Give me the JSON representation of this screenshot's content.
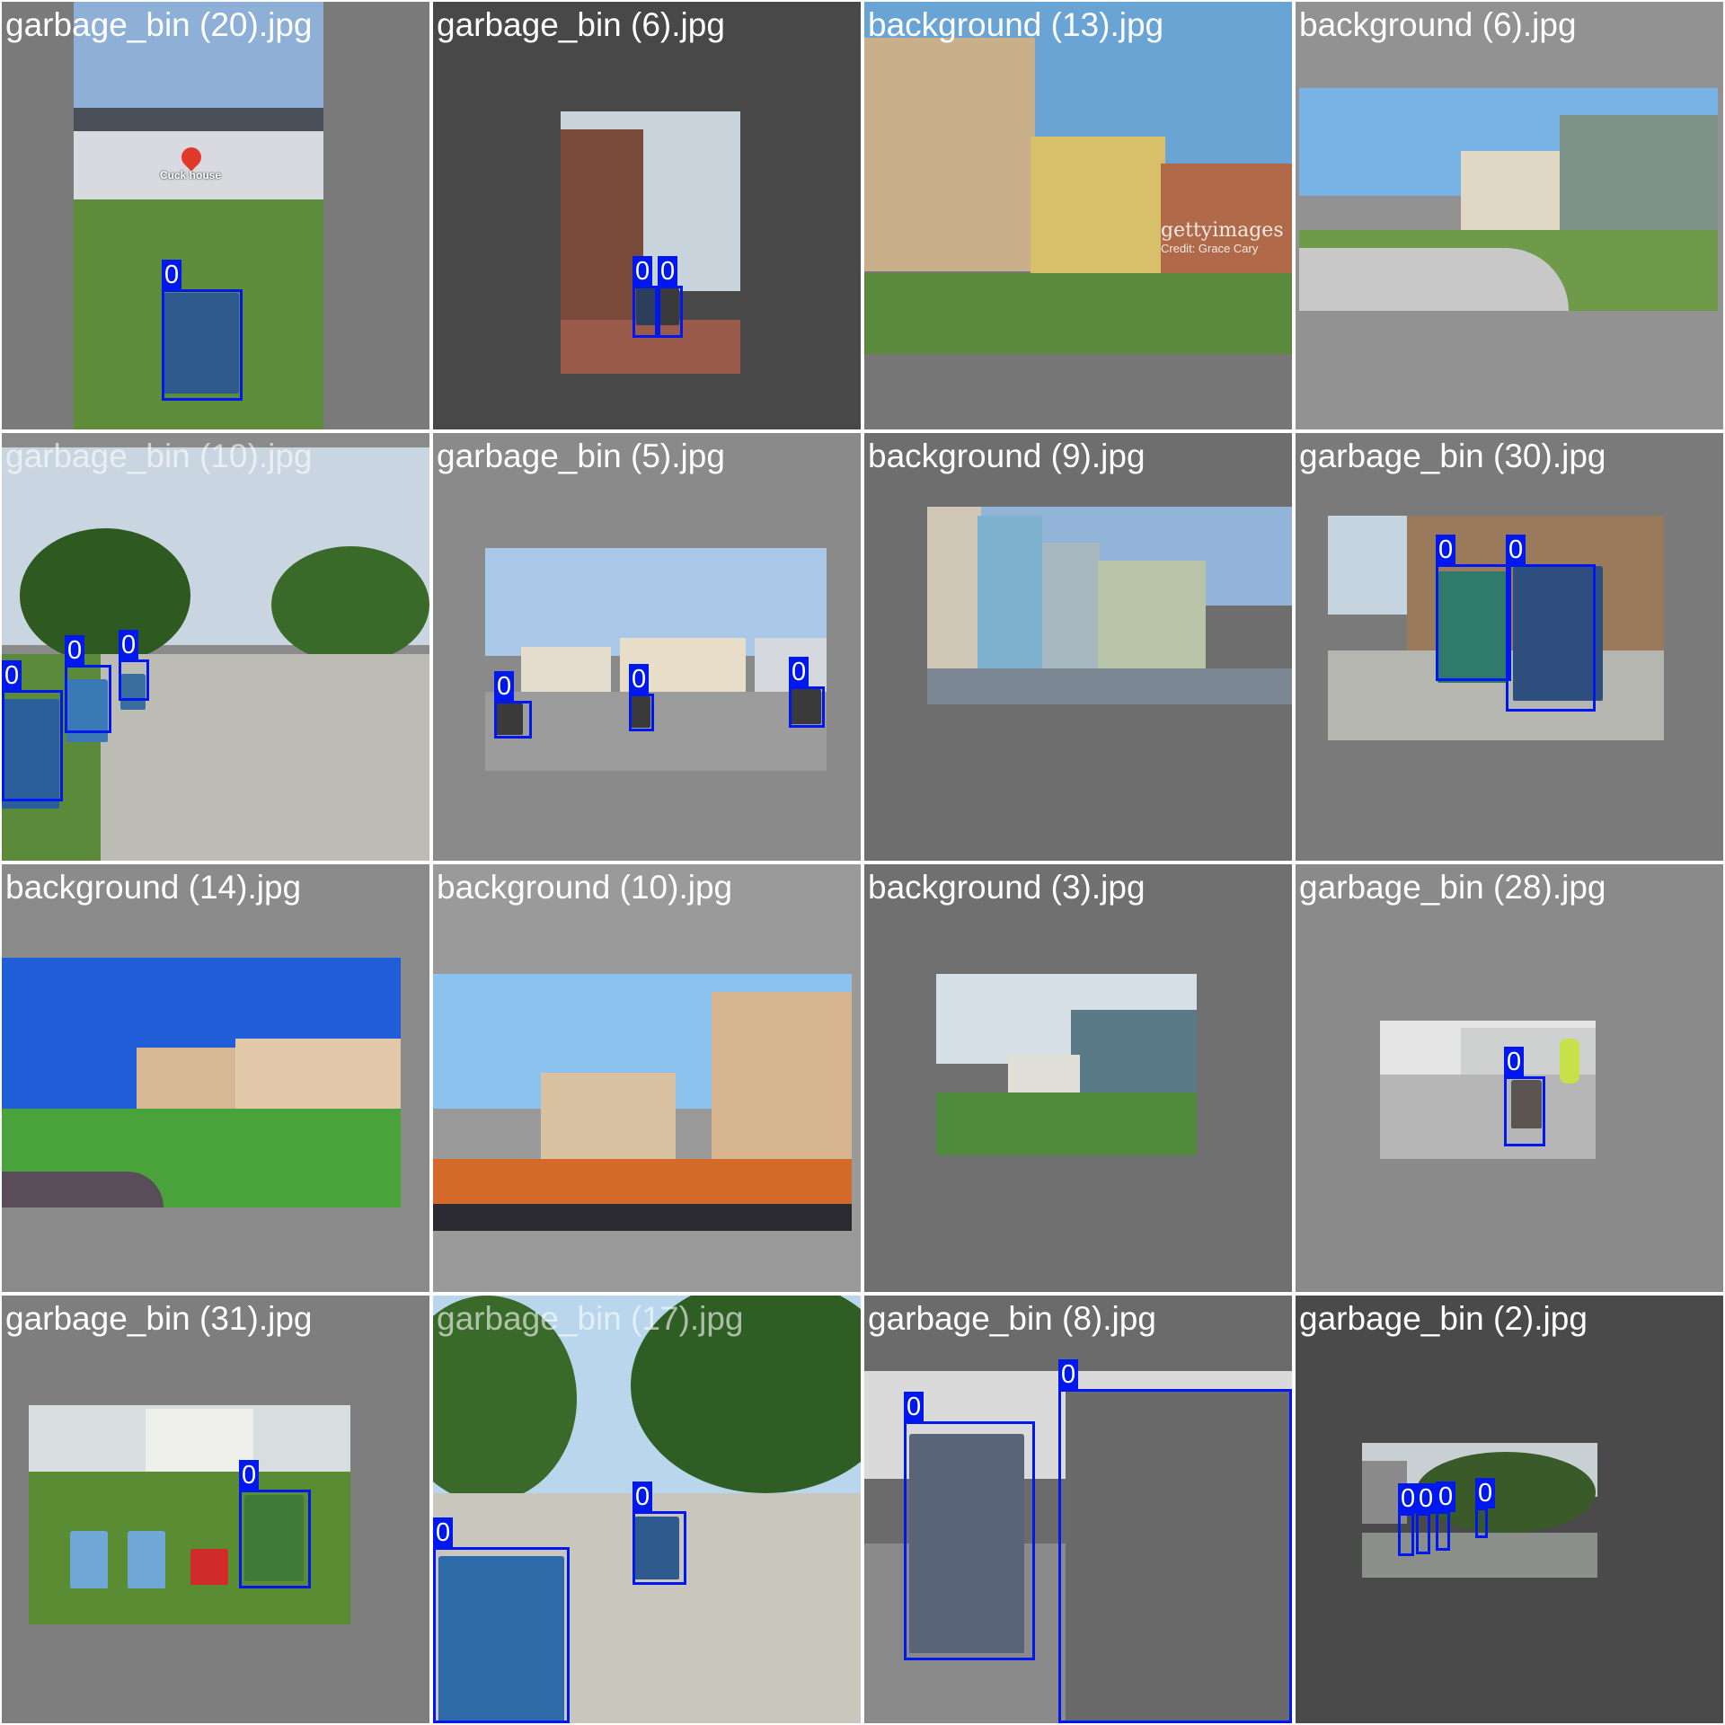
{
  "mosaic": {
    "tiles": [
      {
        "caption": "garbage_bin (20).jpg",
        "bg": "#7a7a7a",
        "scene": "#5d8c3a",
        "sky": "#8fb0d6",
        "labels": [
          "0"
        ],
        "extra_text": [
          "Cuck house"
        ]
      },
      {
        "caption": "garbage_bin (6).jpg",
        "bg": "#484848",
        "scene": "#8d4a3a",
        "sky": "#c9d3dc",
        "labels": [
          "0",
          "0"
        ],
        "extra_text": []
      },
      {
        "caption": "background (13).jpg",
        "bg": "#777777",
        "scene": "#5a8a3c",
        "sky": "#6aa4d4",
        "labels": [],
        "extra_text": [
          "gettyimages",
          "Credit: Grace Cary"
        ]
      },
      {
        "caption": "background (6).jpg",
        "bg": "#929292",
        "scene": "#6f9a4a",
        "sky": "#78b3e6",
        "labels": [],
        "extra_text": []
      },
      {
        "caption": "garbage_bin (10).jpg",
        "bg": "#8b8b8b",
        "scene": "#bcbcb4",
        "sky": "#c9d5e0",
        "labels": [
          "0",
          "0",
          "0"
        ],
        "extra_text": []
      },
      {
        "caption": "garbage_bin (5).jpg",
        "bg": "#8a8a8a",
        "scene": "#9c9c9c",
        "sky": "#a9c8e8",
        "labels": [
          "0",
          "0",
          "0"
        ],
        "extra_text": []
      },
      {
        "caption": "background (9).jpg",
        "bg": "#6e6e6e",
        "scene": "#7b8894",
        "sky": "#92b4d8",
        "labels": [],
        "extra_text": []
      },
      {
        "caption": "garbage_bin (30).jpg",
        "bg": "#7a7a7a",
        "scene": "#9a7a5a",
        "sky": "#c6d4df",
        "labels": [
          "0",
          "0"
        ],
        "extra_text": []
      },
      {
        "caption": "background (14).jpg",
        "bg": "#8b8b8b",
        "scene": "#4aa33a",
        "sky": "#1f5ed8",
        "labels": [],
        "extra_text": []
      },
      {
        "caption": "background (10).jpg",
        "bg": "#9a9a9a",
        "scene": "#d46a2a",
        "sky": "#8cc2ee",
        "labels": [],
        "extra_text": []
      },
      {
        "caption": "background (3).jpg",
        "bg": "#707070",
        "scene": "#4f8a3c",
        "sky": "#d6dee6",
        "labels": [],
        "extra_text": []
      },
      {
        "caption": "garbage_bin (28).jpg",
        "bg": "#8a8a8a",
        "scene": "#b6b6b6",
        "sky": "#e4e4e4",
        "labels": [
          "0"
        ],
        "extra_text": []
      },
      {
        "caption": "garbage_bin (31).jpg",
        "bg": "#7e7e7e",
        "scene": "#5a8c34",
        "sky": "#d8dde0",
        "labels": [
          "0"
        ],
        "extra_text": []
      },
      {
        "caption": "garbage_bin (17).jpg",
        "bg": "#6d6d6d",
        "scene": "#c9c6bd",
        "sky": "#b9d6ec",
        "labels": [
          "0",
          "0"
        ],
        "extra_text": []
      },
      {
        "caption": "garbage_bin (8).jpg",
        "bg": "#6b6b6b",
        "scene": "#8a8a8a",
        "sky": "#dadada",
        "labels": [
          "0",
          "0"
        ],
        "extra_text": []
      },
      {
        "caption": "garbage_bin (2).jpg",
        "bg": "#4a4a4a",
        "scene": "#4d6b3a",
        "sky": "#c9d0d4",
        "labels": [
          "0",
          "0",
          "0",
          "0"
        ],
        "extra_text": []
      }
    ],
    "colors": {
      "box": "#0018f0",
      "caption_text": "#ffffff",
      "divider": "#ffffff"
    }
  }
}
